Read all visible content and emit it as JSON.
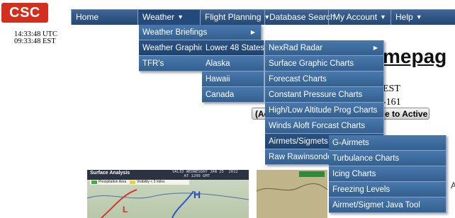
{
  "logo": {
    "text": "CSC"
  },
  "nav": {
    "home": "Home",
    "weather": "Weather",
    "flight_planning": "Flight Planning",
    "database_search": "Database Search",
    "my_account": "My Account",
    "help": "Help"
  },
  "clocks": {
    "utc": "14:33:48 UTC",
    "est": "09:33:48 EST"
  },
  "page": {
    "title_fragment": "mepag",
    "est_fragment": "EST",
    "phone_fragment": "-161",
    "left_button_fragment": "(Ac",
    "right_button_fragment": "e to Active",
    "edge_letter": "A"
  },
  "weather_menu": [
    "Weather Briefings",
    "Weather Graphics",
    "TFR's"
  ],
  "graphics_menu": [
    "Lower 48 States",
    "Alaska",
    "Hawaii",
    "Canada"
  ],
  "lower48_menu": [
    "NexRad Radar",
    "Surface Graphic Charts",
    "Forecast Charts",
    "Constant Pressure Charts",
    "High/Low Altitude Prog Charts",
    "Winds Aloft Forcast Charts",
    "Airmets/Sigmets",
    "Raw Rawinsonde"
  ],
  "airmet_menu": [
    "G-Airmets",
    "Turbulance Charts",
    "Icing Charts",
    "Freezing Levels",
    "Airmet/Sigmet Java Tool"
  ],
  "map": {
    "title": "Surface Analysis",
    "valid": "VALID WEDNESDAY JAN 25  2012\n     AT 1200 GMT",
    "legend_precip": "Precipitation Area",
    "legend_vis": "Visibility < 3 miles"
  },
  "colors": {
    "nav_bg": "#2f5583",
    "menu_bg": "#3b6698",
    "logo_red": "#d32f1f"
  }
}
